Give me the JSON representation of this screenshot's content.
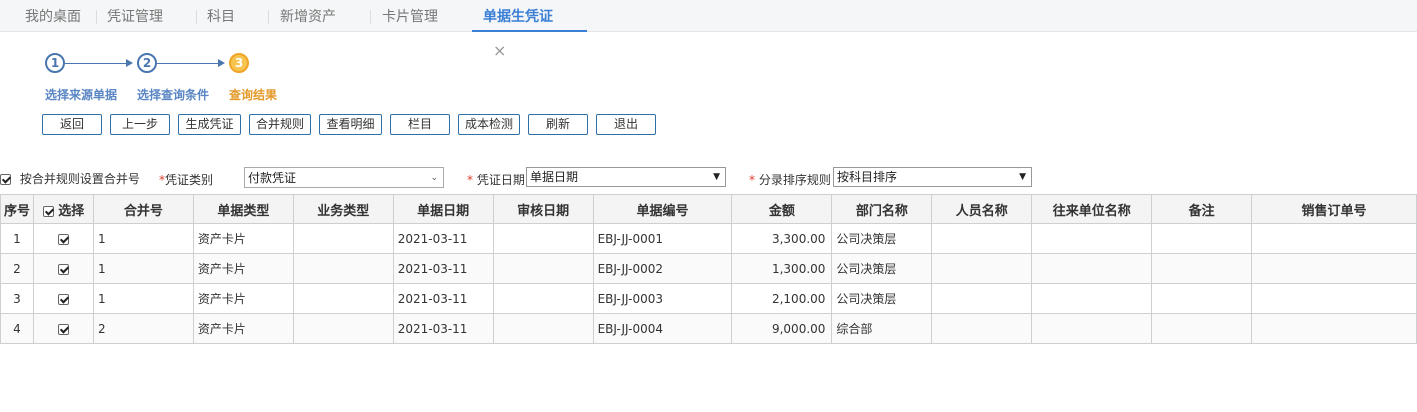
{
  "tabs": [
    {
      "label": "我的桌面"
    },
    {
      "label": "凭证管理"
    },
    {
      "label": "科目"
    },
    {
      "label": "新增资产"
    },
    {
      "label": "卡片管理"
    },
    {
      "label": "单据生凭证",
      "close": "×"
    }
  ],
  "steps": [
    {
      "number": "1",
      "label": "选择来源单据"
    },
    {
      "number": "2",
      "label": "选择查询条件"
    },
    {
      "number": "3",
      "label": "查询结果"
    }
  ],
  "toolbar": {
    "back": "返回",
    "prev": "上一步",
    "generate": "生成凭证",
    "merge_rules": "合并规则",
    "view_detail": "查看明细",
    "columns": "栏目",
    "cost_check": "成本检测",
    "refresh": "刷新",
    "exit": "退出"
  },
  "filters": {
    "merge_checkbox_label": "按合并规则设置合并号",
    "voucher_type_label": "凭证类别",
    "voucher_type_value": "付款凭证",
    "voucher_date_label": "凭证日期",
    "voucher_date_value": "单据日期",
    "sort_rule_label": "分录排序规则",
    "sort_rule_value": "按科目排序",
    "required_mark": "*"
  },
  "table": {
    "headers": {
      "seq": "序号",
      "select": "选择",
      "merge_no": "合并号",
      "doc_type": "单据类型",
      "biz_type": "业务类型",
      "doc_date": "单据日期",
      "audit_date": "审核日期",
      "doc_no": "单据编号",
      "amount": "金额",
      "dept": "部门名称",
      "person": "人员名称",
      "partner": "往来单位名称",
      "remark": "备注",
      "sales_order": "销售订单号"
    },
    "rows": [
      {
        "seq": "1",
        "merge_no": "1",
        "doc_type": "资产卡片",
        "biz_type": "",
        "doc_date": "2021-03-11",
        "audit_date": "",
        "doc_no": "EBJ-JJ-0001",
        "amount": "3,300.00",
        "dept": "公司决策层",
        "person": "",
        "partner": "",
        "remark": "",
        "sales_order": ""
      },
      {
        "seq": "2",
        "merge_no": "1",
        "doc_type": "资产卡片",
        "biz_type": "",
        "doc_date": "2021-03-11",
        "audit_date": "",
        "doc_no": "EBJ-JJ-0002",
        "amount": "1,300.00",
        "dept": "公司决策层",
        "person": "",
        "partner": "",
        "remark": "",
        "sales_order": ""
      },
      {
        "seq": "3",
        "merge_no": "1",
        "doc_type": "资产卡片",
        "biz_type": "",
        "doc_date": "2021-03-11",
        "audit_date": "",
        "doc_no": "EBJ-JJ-0003",
        "amount": "2,100.00",
        "dept": "公司决策层",
        "person": "",
        "partner": "",
        "remark": "",
        "sales_order": ""
      },
      {
        "seq": "4",
        "merge_no": "2",
        "doc_type": "资产卡片",
        "biz_type": "",
        "doc_date": "2021-03-11",
        "audit_date": "",
        "doc_no": "EBJ-JJ-0004",
        "amount": "9,000.00",
        "dept": "综合部",
        "person": "",
        "partner": "",
        "remark": "",
        "sales_order": ""
      }
    ]
  },
  "colors": {
    "accent": "#3a7fd6",
    "step_done": "#4a76b0",
    "step_current": "#f7c44f",
    "required": "#e0402a"
  }
}
